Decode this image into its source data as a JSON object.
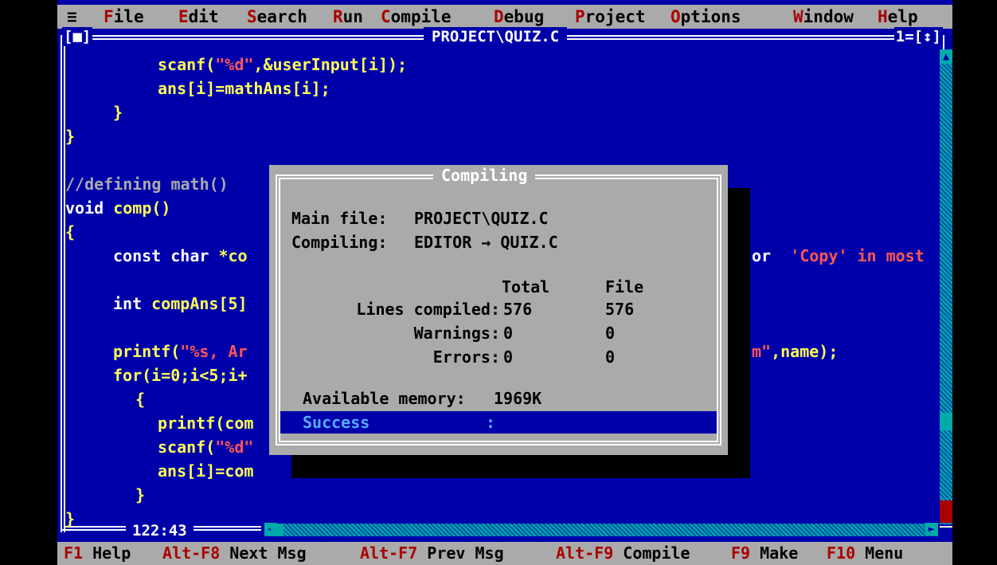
{
  "menu": {
    "system": "≡",
    "items": [
      {
        "hot": "F",
        "rest": "ile"
      },
      {
        "hot": "E",
        "rest": "dit"
      },
      {
        "hot": "S",
        "rest": "earch"
      },
      {
        "hot": "R",
        "rest": "un"
      },
      {
        "hot": "C",
        "rest": "ompile"
      },
      {
        "hot": "D",
        "rest": "ebug"
      },
      {
        "hot": "P",
        "rest": "roject"
      },
      {
        "hot": "O",
        "rest": "ptions"
      },
      {
        "hot": "W",
        "rest": "indow"
      },
      {
        "hot": "H",
        "rest": "elp"
      }
    ]
  },
  "window": {
    "title": "PROJECT\\QUIZ.C",
    "close_box": "[■]",
    "number": "1=[↕]",
    "cursor_position": "122:43"
  },
  "code": {
    "line1": {
      "a": "scanf(",
      "b": "\"%d\"",
      "c": ",&userInput[i]);"
    },
    "line2": "ans[i]=mathAns[i];",
    "line3": "}",
    "line4": "}",
    "line5": "//defining math()",
    "line6": {
      "a": "void ",
      "b": "comp()"
    },
    "line7": "{",
    "line8": {
      "a": "const char ",
      "b": "*co",
      "c": "'Copy' in most s"
    },
    "line9": {
      "a": "int ",
      "b": "compAns[5]"
    },
    "line10": {
      "a": "printf(",
      "b": "\"%s, Ar",
      "c": "m\"",
      "d": ",name);"
    },
    "line11": {
      "a": "for(i=0;i<5;i+"
    },
    "line12": "{",
    "line13": "printf(com",
    "line14": {
      "a": "scanf(",
      "b": "\"%d\""
    },
    "line15": "ans[i]=com",
    "line16": "}",
    "line17": "}",
    "partial_or": "or"
  },
  "dialog": {
    "title": "Compiling",
    "main_file_label": "Main file:",
    "main_file_value": "PROJECT\\QUIZ.C",
    "compiling_label": "Compiling:",
    "compiling_value": "EDITOR → QUIZ.C",
    "col_total": "Total",
    "col_file": "File",
    "rows": [
      {
        "label": "Lines compiled:",
        "total": "576",
        "file": "576"
      },
      {
        "label": "Warnings:",
        "total": "0",
        "file": "0"
      },
      {
        "label": "Errors:",
        "total": "0",
        "file": "0"
      }
    ],
    "memory_label": "Available memory:",
    "memory_value": "1969K",
    "result_label": "Success",
    "result_sep": ":"
  },
  "status": [
    {
      "key": "F1",
      "label": "Help"
    },
    {
      "key": "Alt-F8",
      "label": "Next Msg"
    },
    {
      "key": "Alt-F7",
      "label": "Prev Msg"
    },
    {
      "key": "Alt-F9",
      "label": "Compile"
    },
    {
      "key": "F9",
      "label": "Make"
    },
    {
      "key": "F10",
      "label": "Menu"
    }
  ],
  "colors": {
    "background": "#0000aa",
    "menu": "#aaaaaa",
    "hotkey": "#aa0000",
    "code_text": "#ffff55",
    "string": "#ff5555",
    "success_bar": "#0000aa"
  }
}
